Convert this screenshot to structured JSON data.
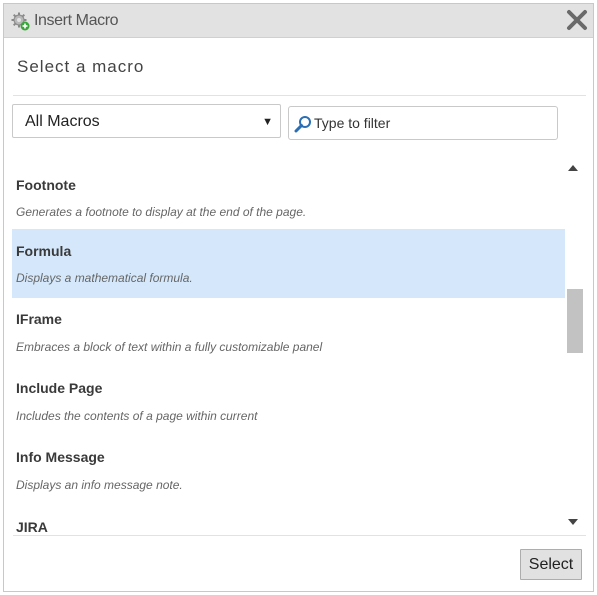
{
  "window": {
    "title": "Insert Macro",
    "icon": "gear-plus-icon",
    "close_icon": "close-icon"
  },
  "heading": "Select a macro",
  "category_select": {
    "selected": "All Macros"
  },
  "filter": {
    "placeholder": "Type to filter",
    "value": ""
  },
  "macros": [
    {
      "name": "Footnote",
      "description": "Generates a footnote to display at the end of the page.",
      "selected": false
    },
    {
      "name": "Formula",
      "description": "Displays a mathematical formula.",
      "selected": true
    },
    {
      "name": "IFrame",
      "description": "Embraces a block of text within a fully customizable panel",
      "selected": false
    },
    {
      "name": "Include Page",
      "description": "Includes the contents of a page within current",
      "selected": false
    },
    {
      "name": "Info Message",
      "description": "Displays an info message note.",
      "selected": false
    },
    {
      "name": "JIRA",
      "description": "",
      "selected": false
    }
  ],
  "footer": {
    "select_button": "Select"
  },
  "colors": {
    "selected_row": "#d5e8fb",
    "titlebar": "#e2e2e2",
    "filter_icon": "#2a6fb5"
  }
}
